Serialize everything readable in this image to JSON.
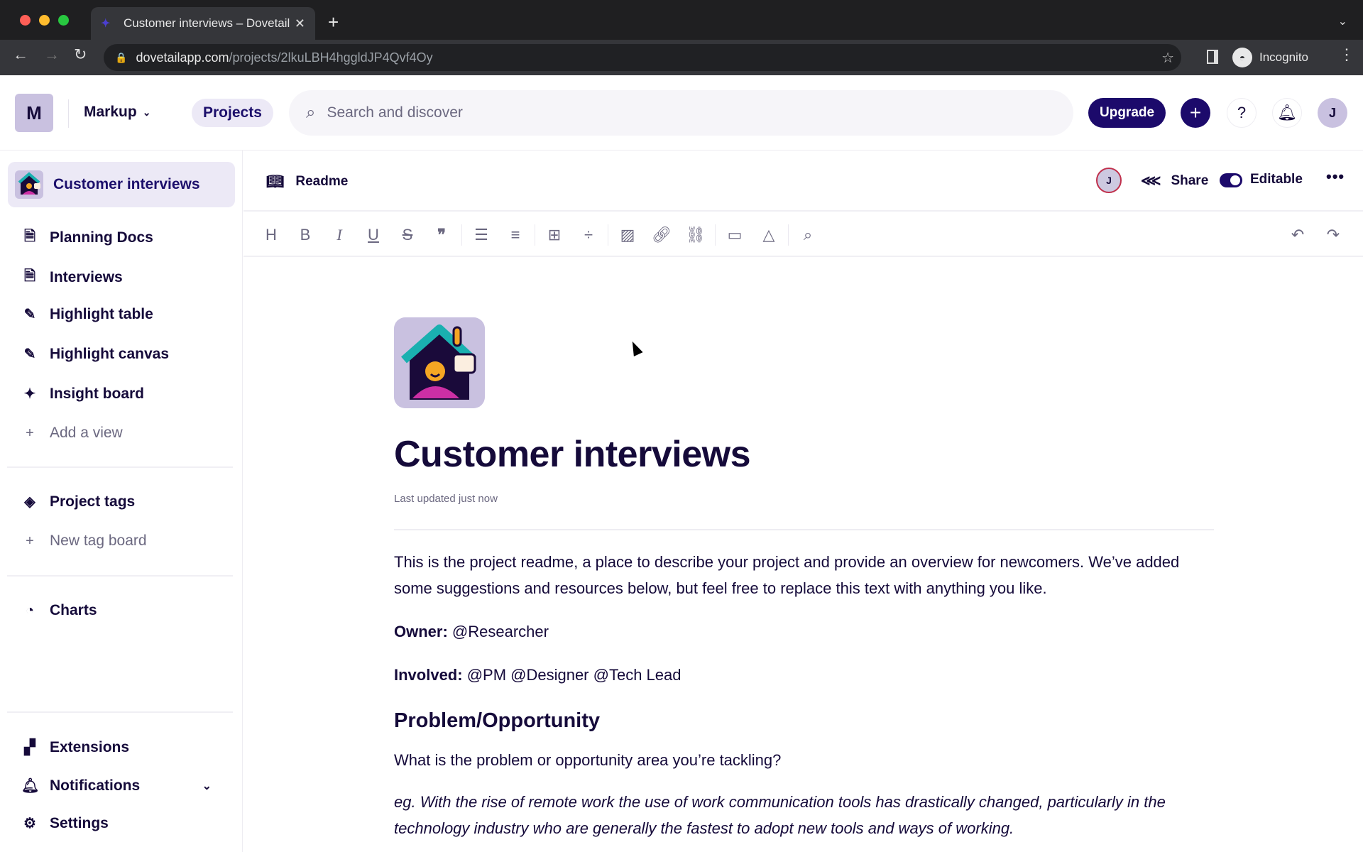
{
  "browser": {
    "tab_title": "Customer interviews – Dovetail",
    "url_domain": "dovetailapp.com",
    "url_path": "/projects/2lkuLBH4hggldJP4Qvf4Oy",
    "profile_label": "Incognito"
  },
  "header": {
    "workspace_initial": "M",
    "workspace_name": "Markup",
    "projects_label": "Projects",
    "search_placeholder": "Search and discover",
    "upgrade_label": "Upgrade",
    "user_initial": "J",
    "colors": {
      "brand": "#1c0a6b",
      "active_bg": "#ece9f6"
    }
  },
  "sidebar": {
    "project_name": "Customer interviews",
    "views": [
      {
        "label": "Planning Docs",
        "icon": "document-icon"
      },
      {
        "label": "Interviews",
        "icon": "document-icon"
      },
      {
        "label": "Highlight table",
        "icon": "highlighter-icon"
      },
      {
        "label": "Highlight canvas",
        "icon": "highlighter-icon"
      },
      {
        "label": "Insight board",
        "icon": "sparkle-icon"
      }
    ],
    "add_view_label": "Add a view",
    "tags_label": "Project tags",
    "new_tag_board_label": "New tag board",
    "charts_label": "Charts",
    "extensions_label": "Extensions",
    "notifications_label": "Notifications",
    "settings_label": "Settings"
  },
  "docbar": {
    "readme_label": "Readme",
    "collaborator_initial": "J",
    "share_label": "Share",
    "editable_label": "Editable",
    "editable_on": true
  },
  "toolbar": {
    "tools": [
      "heading",
      "bold",
      "italic",
      "underline",
      "strikethrough",
      "quote",
      "bullet-list",
      "numbered-list",
      "table",
      "divider",
      "image",
      "link",
      "unlink",
      "video",
      "google-drive",
      "find"
    ]
  },
  "document": {
    "title": "Customer interviews",
    "updated": "Last updated just now",
    "intro": "This is the project readme, a place to describe your project and provide an overview for newcomers. We’ve added some suggestions and resources below, but feel free to replace this text with anything you like.",
    "owner_label": "Owner:",
    "owner_value": " @Researcher",
    "involved_label": "Involved:",
    "involved_value": " @PM @Designer @Tech Lead",
    "section_heading": "Problem/Opportunity",
    "question": "What is the problem or opportunity area you’re tackling?",
    "example": "eg. With the rise of remote work the use of work communication tools has drastically changed, particularly in the technology industry who are generally the fastest to adopt new tools and ways of working."
  }
}
